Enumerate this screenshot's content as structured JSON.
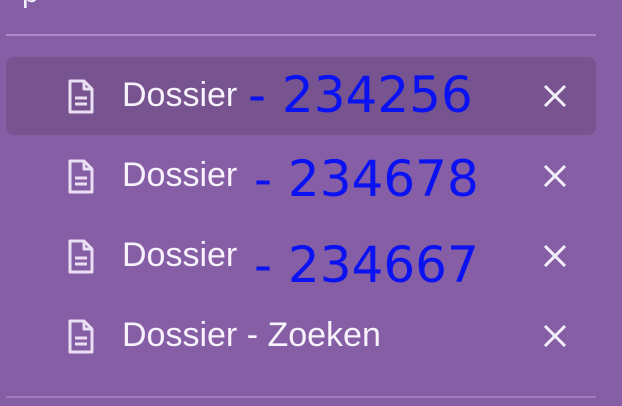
{
  "header": {
    "partial_text": "p"
  },
  "tabs": [
    {
      "label": "Dossier",
      "number": "- 234256",
      "active": true,
      "close_icon": "close-icon"
    },
    {
      "label": "Dossier",
      "number": "- 234678",
      "active": false,
      "close_icon": "close-icon"
    },
    {
      "label": "Dossier",
      "number": "- 234667",
      "active": false,
      "close_icon": "close-icon"
    },
    {
      "label": "Dossier - Zoeken",
      "number": "",
      "active": false,
      "close_icon": "close-icon"
    }
  ],
  "icons": {
    "document": "document-icon",
    "close": "close-icon"
  },
  "colors": {
    "background": "#865ea6",
    "active_row": "#77538f",
    "text": "#f7f2fb",
    "number_annotation": "#0a12f2"
  }
}
